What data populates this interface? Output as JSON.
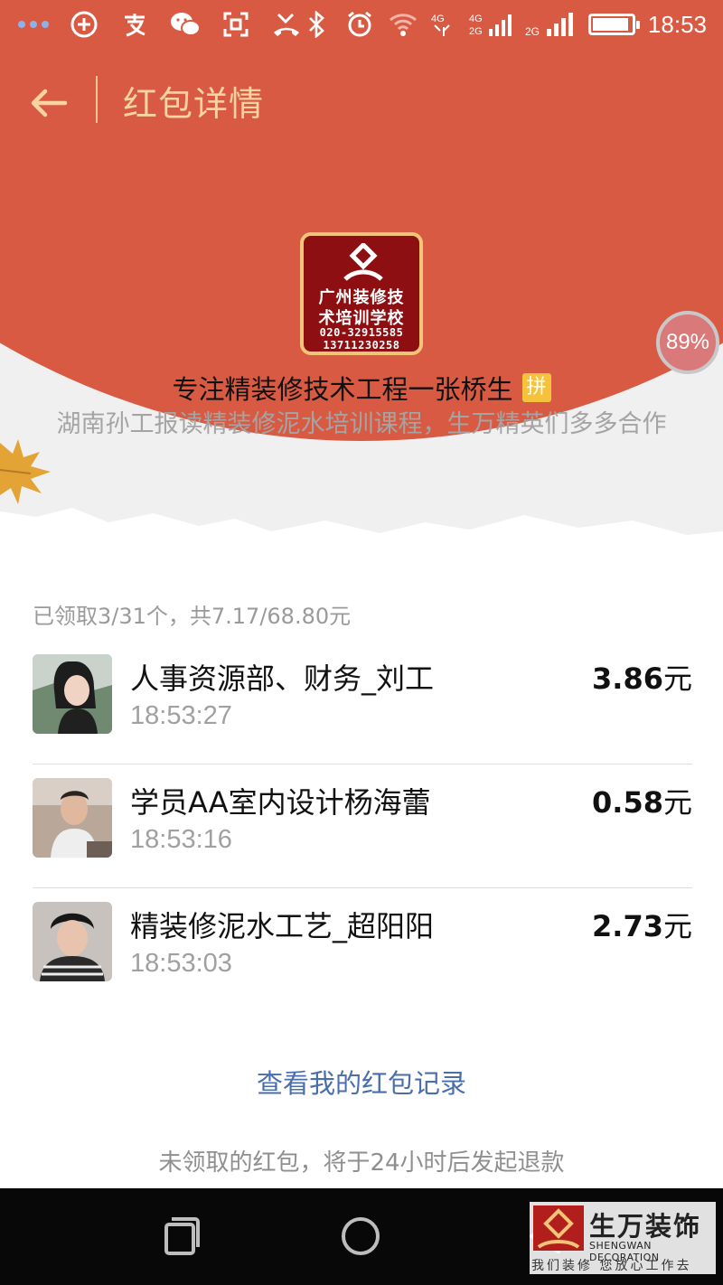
{
  "status_bar": {
    "time": "18:53",
    "left_icons": [
      "more-dots-icon",
      "add-circle-icon",
      "alipay-icon",
      "wechat-icon",
      "scan-icon",
      "missed-call-icon"
    ],
    "right_icons": [
      "bluetooth-icon",
      "alarm-icon",
      "wifi-icon",
      "signal-4g-icon",
      "signal-4g-icon",
      "signal-2g-icon",
      "battery-icon"
    ],
    "battery_level": 0.85
  },
  "header": {
    "title": "红包详情",
    "back_icon": "arrow-left-icon"
  },
  "sender": {
    "logo": {
      "line1": "广州装修技",
      "line2": "术培训学校",
      "line3": "020-32915585",
      "line4": "13711230258"
    },
    "name": "专注精装修技术工程一张桥生",
    "badge": "拼",
    "greeting": "湖南孙工报读精装修泥水培训课程，生万精英们多多合作"
  },
  "float_badge": {
    "label": "89%"
  },
  "summary": "已领取3/31个，共7.17/68.80元",
  "records": [
    {
      "name": "人事资源部、财务_刘工",
      "time": "18:53:27",
      "amount": "3.86",
      "unit": "元"
    },
    {
      "name": "学员AA室内设计杨海蕾",
      "time": "18:53:16",
      "amount": "0.58",
      "unit": "元"
    },
    {
      "name": "精装修泥水工艺_超阳阳",
      "time": "18:53:03",
      "amount": "2.73",
      "unit": "元"
    }
  ],
  "footer": {
    "record_link": "查看我的红包记录",
    "refund_note": "未领取的红包，将于24小时后发起退款"
  },
  "nav_bar": {
    "icons": [
      "recent-apps-icon",
      "home-icon",
      "back-triangle-icon"
    ]
  },
  "watermark": {
    "title": "生万装饰",
    "english": "SHENGWAN DECORATION",
    "slogan": "我们装修 您放心工作去"
  },
  "colors": {
    "header_red": "#d95a42",
    "title_gold": "#f7d3a0",
    "link_blue": "#4a6eab",
    "logo_red": "#8e0f12"
  }
}
